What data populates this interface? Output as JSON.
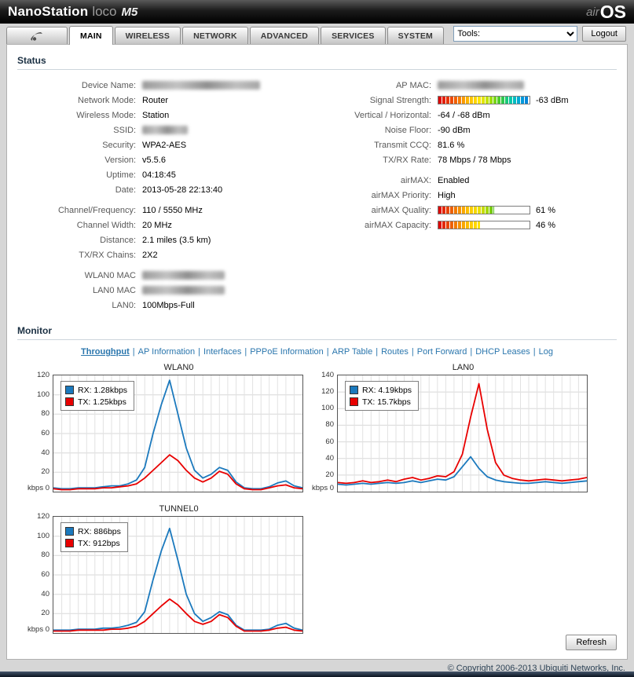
{
  "header": {
    "product_name": "NanoStation",
    "product_variant": "loco",
    "product_model": "M5",
    "os_brand_prefix": "air",
    "os_brand_suffix": "OS"
  },
  "nav": {
    "tabs": [
      {
        "label": "MAIN",
        "active": true
      },
      {
        "label": "WIRELESS",
        "active": false
      },
      {
        "label": "NETWORK",
        "active": false
      },
      {
        "label": "ADVANCED",
        "active": false
      },
      {
        "label": "SERVICES",
        "active": false
      },
      {
        "label": "SYSTEM",
        "active": false
      }
    ],
    "tools_label": "Tools:",
    "logout_label": "Logout"
  },
  "status": {
    "title": "Status",
    "left_rows": [
      {
        "label": "Device Name:",
        "redacted": true,
        "redacted_width": 150
      },
      {
        "label": "Network Mode:",
        "value": "Router"
      },
      {
        "label": "Wireless Mode:",
        "value": "Station"
      },
      {
        "label": "SSID:",
        "redacted": true,
        "redacted_width": 58
      },
      {
        "label": "Security:",
        "value": "WPA2-AES"
      },
      {
        "label": "Version:",
        "value": "v5.5.6"
      },
      {
        "label": "Uptime:",
        "value": "04:18:45"
      },
      {
        "label": "Date:",
        "value": "2013-05-28 22:13:40"
      },
      {
        "label": "Channel/Frequency:",
        "value": "110 / 5550 MHz",
        "gap": true
      },
      {
        "label": "Channel Width:",
        "value": "20 MHz"
      },
      {
        "label": "Distance:",
        "value": "2.1 miles (3.5 km)"
      },
      {
        "label": "TX/RX Chains:",
        "value": "2X2"
      },
      {
        "label": "WLAN0 MAC",
        "redacted": true,
        "redacted_width": 105,
        "gap": true
      },
      {
        "label": "LAN0 MAC",
        "redacted": true,
        "redacted_width": 105
      },
      {
        "label": "LAN0:",
        "value": "100Mbps-Full"
      }
    ],
    "right_rows": [
      {
        "label": "AP MAC:",
        "redacted": true,
        "redacted_width": 110
      },
      {
        "label": "Signal Strength:",
        "gauge": {
          "kind": "signal",
          "fill_pct": 98
        },
        "value": "-63 dBm"
      },
      {
        "label": "Vertical / Horizontal:",
        "value": "-64 / -68 dBm"
      },
      {
        "label": "Noise Floor:",
        "value": "-90 dBm"
      },
      {
        "label": "Transmit CCQ:",
        "value": "81.6 %"
      },
      {
        "label": "TX/RX Rate:",
        "value": "78 Mbps / 78 Mbps"
      },
      {
        "label": "airMAX:",
        "value": "Enabled",
        "gap": true
      },
      {
        "label": "airMAX Priority:",
        "value": "High"
      },
      {
        "label": "airMAX Quality:",
        "gauge": {
          "kind": "quality",
          "fill_pct": 61
        },
        "value": "61 %"
      },
      {
        "label": "airMAX Capacity:",
        "gauge": {
          "kind": "capacity",
          "fill_pct": 46
        },
        "value": "46 %"
      }
    ]
  },
  "monitor": {
    "title": "Monitor",
    "links": [
      {
        "label": "Throughput",
        "active": true
      },
      {
        "label": "AP Information",
        "active": false
      },
      {
        "label": "Interfaces",
        "active": false
      },
      {
        "label": "PPPoE Information",
        "active": false
      },
      {
        "label": "ARP Table",
        "active": false
      },
      {
        "label": "Routes",
        "active": false
      },
      {
        "label": "Port Forward",
        "active": false
      },
      {
        "label": "DHCP Leases",
        "active": false
      },
      {
        "label": "Log",
        "active": false
      }
    ],
    "refresh_label": "Refresh"
  },
  "chart_data": [
    {
      "type": "line",
      "title": "WLAN0",
      "ylabel": "kbps",
      "ylim": [
        0,
        120
      ],
      "ytick_step": 20,
      "x_divisions": 30,
      "grid": true,
      "legend_position": "top-left",
      "series": [
        {
          "name": "RX: 1.28kbps",
          "color": "#1b79bd",
          "values": [
            4,
            3,
            3,
            4,
            4,
            4,
            5,
            6,
            6,
            8,
            12,
            25,
            60,
            90,
            115,
            80,
            45,
            22,
            14,
            18,
            25,
            22,
            10,
            4,
            3,
            3,
            5,
            9,
            11,
            6,
            4
          ]
        },
        {
          "name": "TX: 1.25kbps",
          "color": "#e80000",
          "values": [
            3,
            2,
            2,
            3,
            3,
            3,
            4,
            4,
            5,
            6,
            8,
            14,
            22,
            30,
            38,
            32,
            22,
            14,
            10,
            14,
            21,
            18,
            8,
            3,
            2,
            2,
            4,
            6,
            7,
            4,
            3
          ]
        }
      ]
    },
    {
      "type": "line",
      "title": "LAN0",
      "ylabel": "kbps",
      "ylim": [
        0,
        140
      ],
      "ytick_step": 20,
      "x_divisions": 30,
      "grid": true,
      "legend_position": "top-left",
      "series": [
        {
          "name": "RX: 4.19kbps",
          "color": "#1b79bd",
          "values": [
            9,
            8,
            9,
            10,
            9,
            10,
            11,
            10,
            11,
            13,
            11,
            13,
            15,
            14,
            18,
            30,
            42,
            28,
            18,
            14,
            12,
            11,
            10,
            10,
            11,
            12,
            11,
            10,
            11,
            12,
            13
          ]
        },
        {
          "name": "TX: 15.7kbps",
          "color": "#e80000",
          "values": [
            11,
            10,
            11,
            13,
            11,
            12,
            14,
            12,
            15,
            17,
            14,
            16,
            19,
            18,
            24,
            45,
            90,
            130,
            75,
            35,
            20,
            16,
            14,
            13,
            14,
            15,
            14,
            13,
            14,
            15,
            17
          ]
        }
      ]
    },
    {
      "type": "line",
      "title": "TUNNEL0",
      "ylabel": "kbps",
      "ylim": [
        0,
        120
      ],
      "ytick_step": 20,
      "x_divisions": 30,
      "grid": true,
      "legend_position": "top-left",
      "series": [
        {
          "name": "RX: 886bps",
          "color": "#1b79bd",
          "values": [
            3,
            3,
            3,
            4,
            4,
            4,
            5,
            5,
            6,
            8,
            11,
            22,
            55,
            85,
            108,
            75,
            40,
            20,
            12,
            16,
            22,
            19,
            8,
            3,
            3,
            3,
            4,
            8,
            10,
            5,
            3
          ]
        },
        {
          "name": "TX: 912bps",
          "color": "#e80000",
          "values": [
            2,
            2,
            2,
            3,
            3,
            3,
            3,
            4,
            4,
            5,
            7,
            12,
            20,
            28,
            35,
            29,
            20,
            12,
            9,
            12,
            19,
            16,
            7,
            2,
            2,
            2,
            3,
            5,
            6,
            3,
            2
          ]
        }
      ]
    }
  ],
  "footer": {
    "copyright": "© Copyright 2006-2013 Ubiquiti Networks, Inc."
  }
}
